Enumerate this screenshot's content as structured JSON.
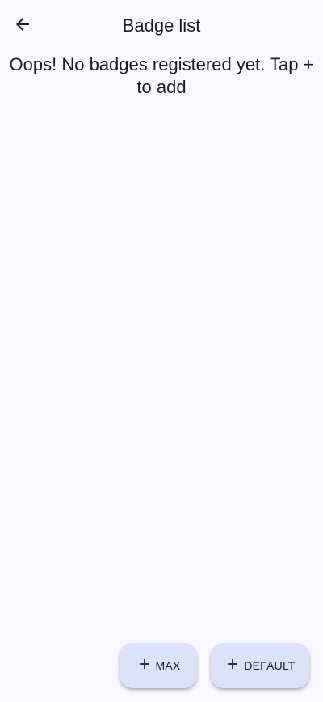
{
  "app_bar": {
    "title": "Badge list",
    "back_icon": "arrow-back-icon"
  },
  "main": {
    "empty_message": "Oops! No badges registered yet. Tap + to add"
  },
  "fabs": {
    "max_label": "MAX",
    "default_label": "DEFAULT",
    "icon": "plus-icon"
  },
  "colors": {
    "background": "#f9f8fe",
    "fab_background": "#dde2fb",
    "text": "#1b1b20"
  }
}
